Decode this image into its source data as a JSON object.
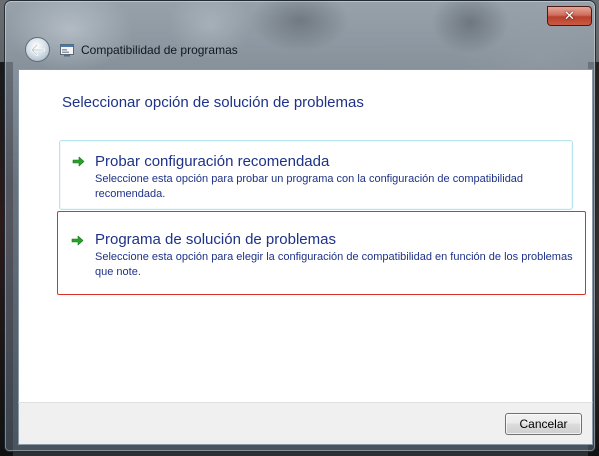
{
  "window": {
    "title": "Compatibilidad de programas",
    "close_glyph": "✕",
    "back_icon": "back-arrow-icon",
    "app_icon": "program-compatibility-icon"
  },
  "main": {
    "heading": "Seleccionar opción de solución de problemas",
    "options": [
      {
        "title": "Probar configuración recomendada",
        "description": "Seleccione esta opción para probar un programa con la configuración de compatibilidad recomendada.",
        "icon": "green-arrow-icon",
        "state": "hover"
      },
      {
        "title": "Programa de solución de problemas",
        "description": "Seleccione esta opción para elegir la configuración de compatibilidad en función de los problemas que note.",
        "icon": "green-arrow-icon",
        "state": "highlighted"
      }
    ]
  },
  "footer": {
    "cancel_label": "Cancelar"
  },
  "colors": {
    "link_text": "#1e3287",
    "option_hover_border": "#b6e4f1",
    "highlight_border": "#d9342c",
    "arrow_green": "#2aa02a",
    "close_button": "#c95b43"
  }
}
